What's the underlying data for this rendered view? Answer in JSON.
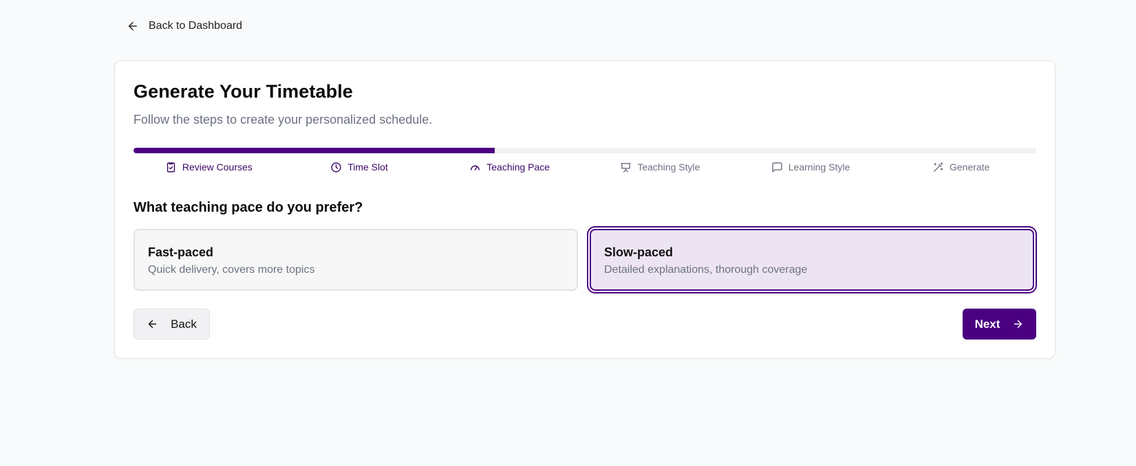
{
  "nav": {
    "back_label": "Back to Dashboard"
  },
  "card": {
    "title": "Generate Your Timetable",
    "subtitle": "Follow the steps to create your personalized schedule."
  },
  "progress": {
    "fraction": 0.4
  },
  "steps": [
    {
      "label": "Review Courses",
      "icon": "clipboard-check-icon",
      "active": true
    },
    {
      "label": "Time Slot",
      "icon": "clock-icon",
      "active": true
    },
    {
      "label": "Teaching Pace",
      "icon": "gauge-icon",
      "active": true
    },
    {
      "label": "Teaching Style",
      "icon": "presentation-icon",
      "active": false
    },
    {
      "label": "Learning Style",
      "icon": "message-square-icon",
      "active": false
    },
    {
      "label": "Generate",
      "icon": "magic-wand-icon",
      "active": false
    }
  ],
  "question": "What teaching pace do you prefer?",
  "options": [
    {
      "title": "Fast-paced",
      "description": "Quick delivery, covers more topics",
      "selected": false
    },
    {
      "title": "Slow-paced",
      "description": "Detailed explanations, thorough coverage",
      "selected": true
    }
  ],
  "buttons": {
    "back_label": "Back",
    "next_label": "Next"
  },
  "colors": {
    "accent": "#4b0082",
    "selected_bg": "#ede4f3",
    "muted_text": "#6b7280"
  }
}
